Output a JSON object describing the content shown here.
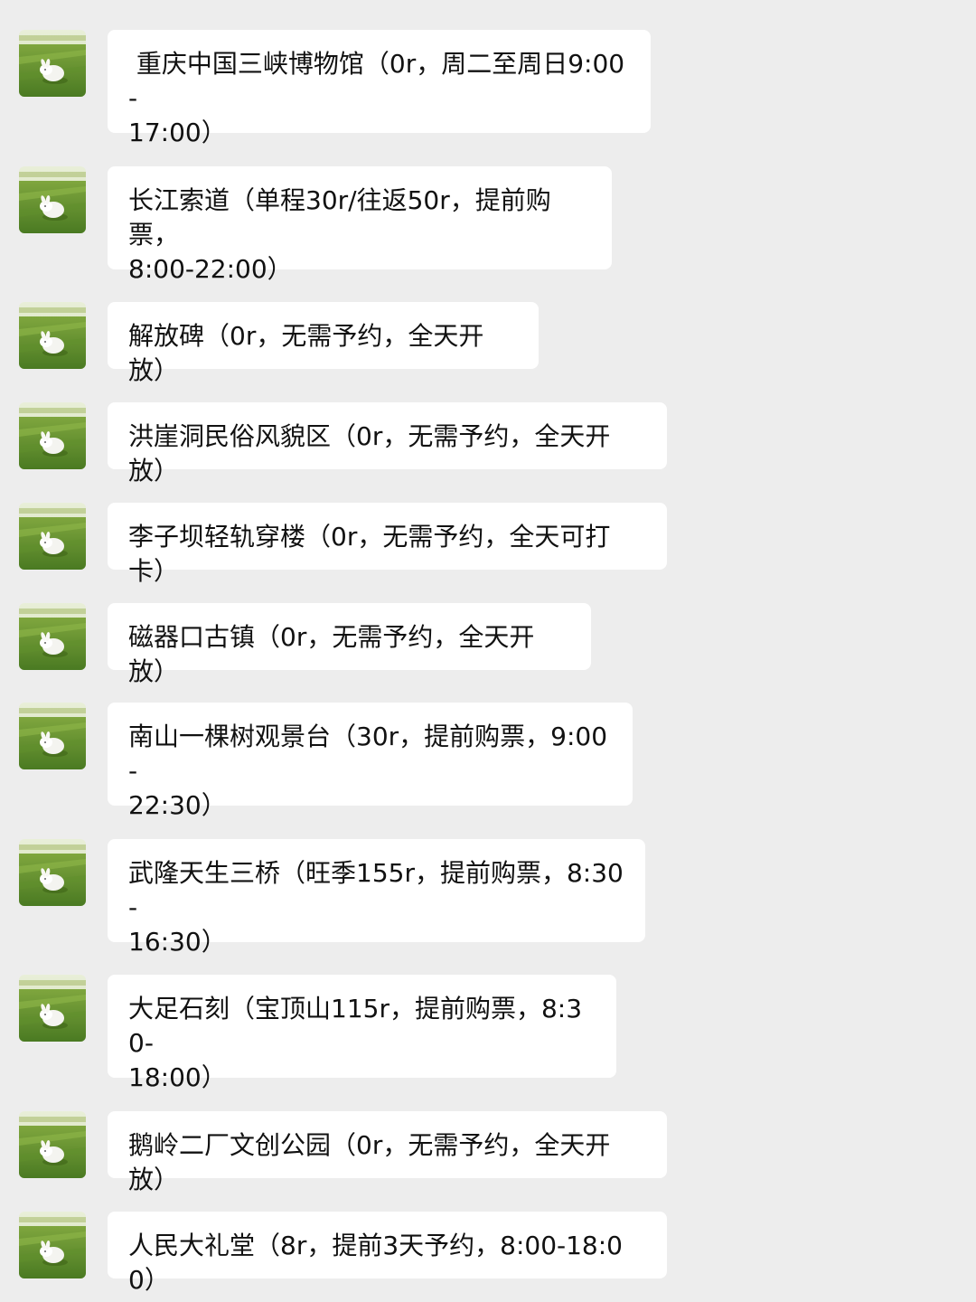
{
  "messages": [
    {
      "text": " 重庆中国三峡博物馆（0r，周二至周日9:00-\n17:00）"
    },
    {
      "text": "长江索道（单程30r/往返50r，提前购票，\n8:00-22:00）"
    },
    {
      "text": "解放碑（0r，无需予约，全天开放）"
    },
    {
      "text": "洪崖洞民俗风貌区（0r，无需予约，全天开放）"
    },
    {
      "text": "李子坝轻轨穿楼（0r，无需予约，全天可打卡）"
    },
    {
      "text": "磁器口古镇（0r，无需予约，全天开放）"
    },
    {
      "text": "南山一棵树观景台（30r，提前购票，9:00-\n22:30）"
    },
    {
      "text": "武隆天生三桥（旺季155r，提前购票，8:30-\n16:30）"
    },
    {
      "text": "大足石刻（宝顶山115r，提前购票，8:30-\n18:00）"
    },
    {
      "text": "鹅岭二厂文创公园（0r，无需予约，全天开放）"
    },
    {
      "text": "人民大礼堂（8r，提前3天予约，8:00-18:00）"
    }
  ],
  "avatar": {
    "icon": "rabbit-on-grass-avatar"
  },
  "colors": {
    "background": "#ededed",
    "bubble": "#ffffff",
    "text": "#111111"
  }
}
